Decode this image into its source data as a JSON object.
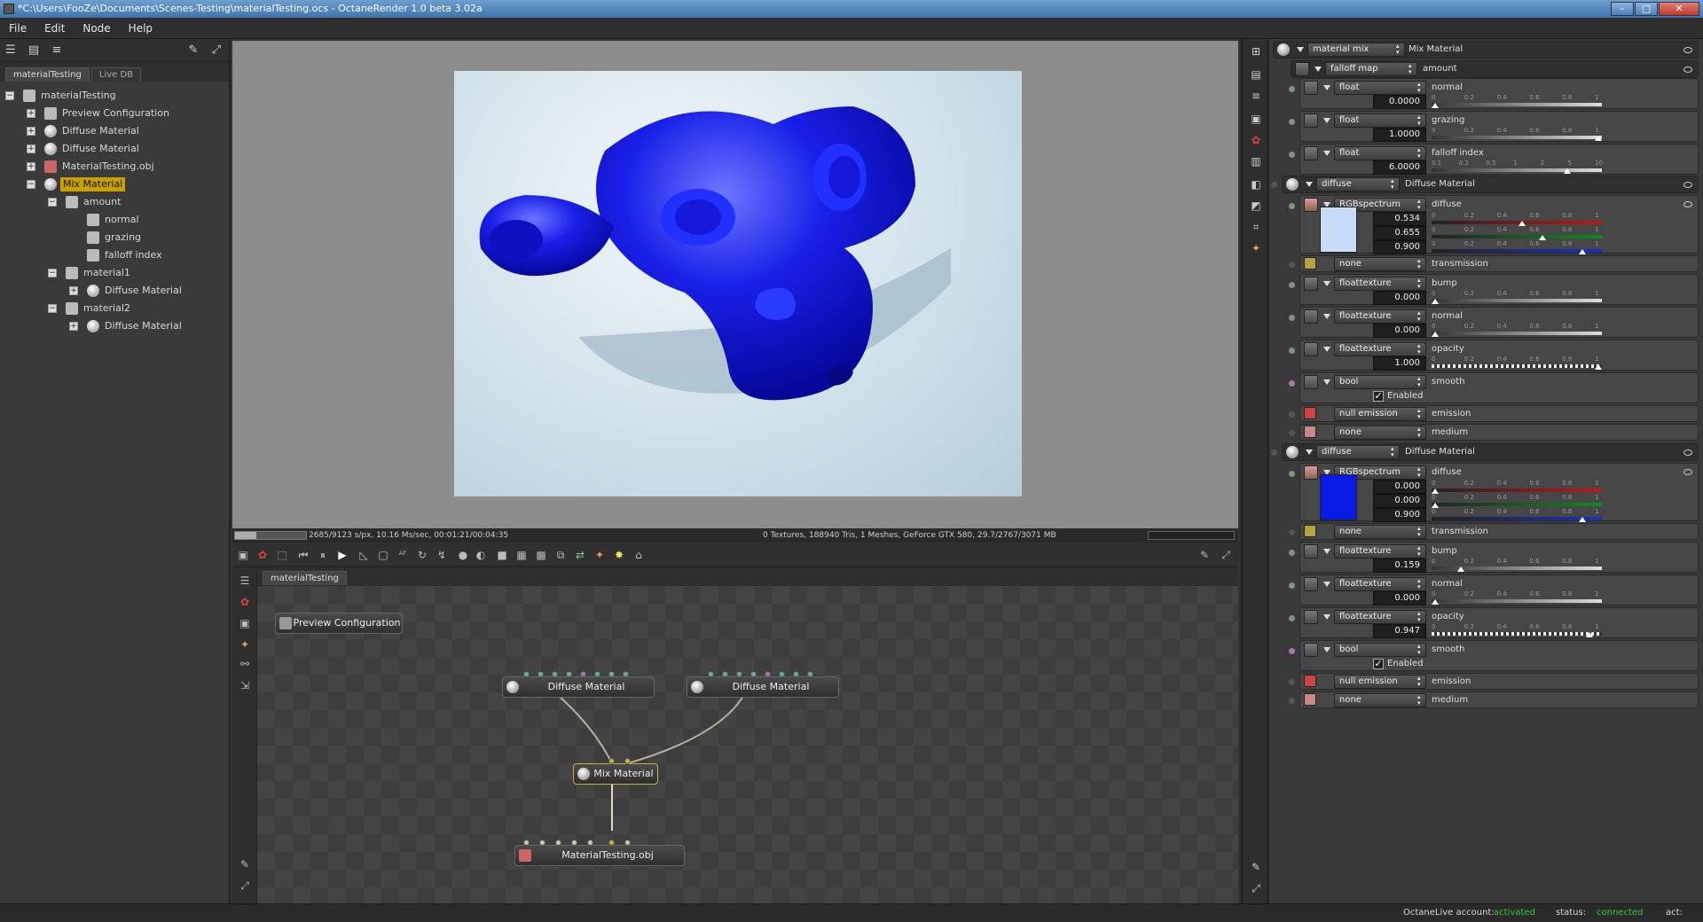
{
  "window": {
    "title": "*C:\\Users\\FooZe\\Documents\\Scenes-Testing\\materialTesting.ocs - OctaneRender 1.0 beta 3.02a"
  },
  "menu": [
    "File",
    "Edit",
    "Node",
    "Help"
  ],
  "outliner": {
    "tabs": [
      "materialTesting",
      "Live DB"
    ],
    "items": [
      "materialTesting",
      "Preview Configuration",
      "Diffuse Material",
      "Diffuse Material",
      "MaterialTesting.obj",
      "Mix Material",
      "amount",
      "normal",
      "grazing",
      "falloff index",
      "material1",
      "Diffuse Material",
      "material2",
      "Diffuse Material"
    ]
  },
  "render": {
    "stats_left": "2685/9123 s/px, 10.16 Ms/sec, 00:01:21/00:04:35",
    "stats_right": "0 Textures, 188940 Tris, 1 Meshes, GeForce GTX 580, 29.7/2767/3071 MB",
    "progress": 0.294,
    "colors": {
      "mesh": "#1a1fe8",
      "background": "#dbe9f0"
    }
  },
  "graph": {
    "tab": "materialTesting",
    "nodes": {
      "preview": "Preview Configuration",
      "diffuse1": "Diffuse Material",
      "diffuse2": "Diffuse Material",
      "mix": "Mix Material",
      "mesh": "MaterialTesting.obj"
    }
  },
  "inspector": {
    "root": {
      "type": "material mix",
      "name": "Mix Material"
    },
    "amount": {
      "type": "falloff map",
      "name": "amount",
      "params": [
        {
          "type": "float",
          "label": "normal",
          "value": "0.0000",
          "ticks": [
            "0",
            "0.2",
            "0.4",
            "0.6",
            "0.8",
            "1"
          ],
          "pos": 0.0
        },
        {
          "type": "float",
          "label": "grazing",
          "value": "1.0000",
          "ticks": [
            "0",
            "0.2",
            "0.4",
            "0.6",
            "0.8",
            "1"
          ],
          "pos": 1.0
        },
        {
          "type": "float",
          "label": "falloff index",
          "value": "6.0000",
          "ticks": [
            "0.1",
            "0.2",
            "0.5",
            "1",
            "2",
            "5",
            "10"
          ],
          "pos": 0.81
        }
      ]
    },
    "materials": [
      {
        "type": "diffuse",
        "name": "Diffuse Material",
        "diffuse": {
          "type": "RGBspectrum",
          "label": "diffuse",
          "r": "0.534",
          "g": "0.655",
          "b": "0.900",
          "rpos": 0.534,
          "gpos": 0.655,
          "bpos": 0.9,
          "swatch": "#c9dcf7"
        },
        "transmission": {
          "type": "none",
          "label": "transmission"
        },
        "bump": {
          "type": "floattexture",
          "label": "bump",
          "value": "0.000",
          "pos": 0.0
        },
        "normal": {
          "type": "floattexture",
          "label": "normal",
          "value": "0.000",
          "pos": 0.0
        },
        "opacity": {
          "type": "floattexture",
          "label": "opacity",
          "value": "1.000",
          "pos": 1.0
        },
        "smooth": {
          "type": "bool",
          "label": "smooth",
          "checkbox": "Enabled"
        },
        "emission": {
          "type": "null emission",
          "label": "emission"
        },
        "medium": {
          "type": "none",
          "label": "medium"
        }
      },
      {
        "type": "diffuse",
        "name": "Diffuse Material",
        "diffuse": {
          "type": "RGBspectrum",
          "label": "diffuse",
          "r": "0.000",
          "g": "0.000",
          "b": "0.900",
          "rpos": 0.0,
          "gpos": 0.0,
          "bpos": 0.9,
          "swatch": "#0a1ae6"
        },
        "transmission": {
          "type": "none",
          "label": "transmission"
        },
        "bump": {
          "type": "floattexture",
          "label": "bump",
          "value": "0.159",
          "pos": 0.159
        },
        "normal": {
          "type": "floattexture",
          "label": "normal",
          "value": "0.000",
          "pos": 0.0
        },
        "opacity": {
          "type": "floattexture",
          "label": "opacity",
          "value": "0.947",
          "pos": 0.947
        },
        "smooth": {
          "type": "bool",
          "label": "smooth",
          "checkbox": "Enabled"
        },
        "emission": {
          "type": "null emission",
          "label": "emission"
        },
        "medium": {
          "type": "none",
          "label": "medium"
        }
      }
    ],
    "ticks": [
      "0",
      "0.2",
      "0.4",
      "0.6",
      "0.8",
      "1"
    ]
  },
  "status": {
    "account_label": "OctaneLive account:",
    "account_value": "activated",
    "status_label": "status:",
    "status_value": "connected",
    "act_label": "act:",
    "ok_color": "#33cc33"
  }
}
